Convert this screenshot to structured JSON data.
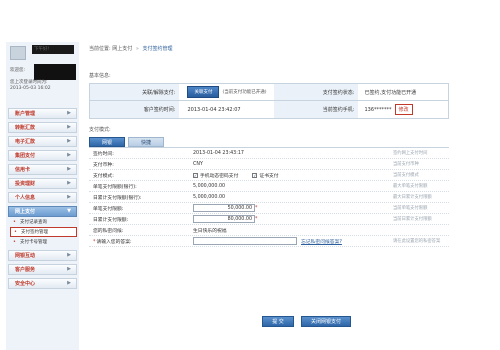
{
  "sidebar": {
    "username": "下午好!",
    "last_login_label": "欢迎您:",
    "last_login_time": "您上次登录时间为:",
    "last_login_ip": "2013-05-03 16:02",
    "last_login_date": "",
    "nav": [
      {
        "label": "账户管理"
      },
      {
        "label": "转账汇款"
      },
      {
        "label": "电子汇款"
      },
      {
        "label": "集团支付"
      },
      {
        "label": "信用卡"
      },
      {
        "label": "投资理财"
      },
      {
        "label": "个人信息"
      },
      {
        "label": "网上支付"
      }
    ],
    "sub_items": [
      {
        "label": "支付记录查询"
      },
      {
        "label": "支付签约管理"
      },
      {
        "label": "支付卡号管理"
      }
    ],
    "nav_bottom": [
      {
        "label": "网银互动"
      },
      {
        "label": "客户服务"
      },
      {
        "label": "安全中心"
      }
    ]
  },
  "breadcrumb": {
    "prefix": "当前位置:",
    "level1": "网上支付",
    "level2": "支付签约管理"
  },
  "basic": {
    "title": "基本信息:",
    "row1_label": "关联/解除支付:",
    "cert_button": "关联支付",
    "cert_note": "(当前支付功能已开通)",
    "row1_label2": "支付签约状态:",
    "row1_value2": "已签约,支付功能已开通",
    "row2_label": "客户签约时间:",
    "row2_value": "2013-01-04 23:42:07",
    "row2_label2": "当前签约手机:",
    "phone": "136*******",
    "modify_button": "修改"
  },
  "detail": {
    "title": "支付模式:",
    "tabs": [
      {
        "label": "网银"
      },
      {
        "label": "快捷"
      }
    ],
    "rows": [
      {
        "label": "签约时间:",
        "value": "2013-01-04 23:43:17",
        "note": "签约网上支付时间"
      },
      {
        "label": "支付币种:",
        "value": "CNY",
        "note": "当前支付币种"
      },
      {
        "label": "支付模式:",
        "value": "",
        "note": "当前支付模式"
      },
      {
        "label": "单笔支付限额(银行):",
        "value": "5,000,000.00",
        "note": "最大单笔支付限额"
      },
      {
        "label": "日累计支付限额(银行):",
        "value": "5,000,000.00",
        "note": "最大日累计支付限额"
      },
      {
        "label": "单笔支付限额:",
        "value": "50,000.00",
        "note": "当前单笔支付限额"
      },
      {
        "label": "日累计支付限额:",
        "value": "80,000.00",
        "note": "当前日累计支付限额"
      },
      {
        "label": "您的私密问候:",
        "value": "生日快乐的祝福",
        "note": ""
      },
      {
        "label": "请输入您的答案:",
        "value": "",
        "note": "请在此设置您的私密答案"
      }
    ],
    "check_mobile": "手机动态密码支付",
    "check_cert": "证书支付",
    "unclear_link": "忘记私密问候答案?"
  },
  "actions": {
    "submit": "提 交",
    "close": "关闭网银支付"
  }
}
